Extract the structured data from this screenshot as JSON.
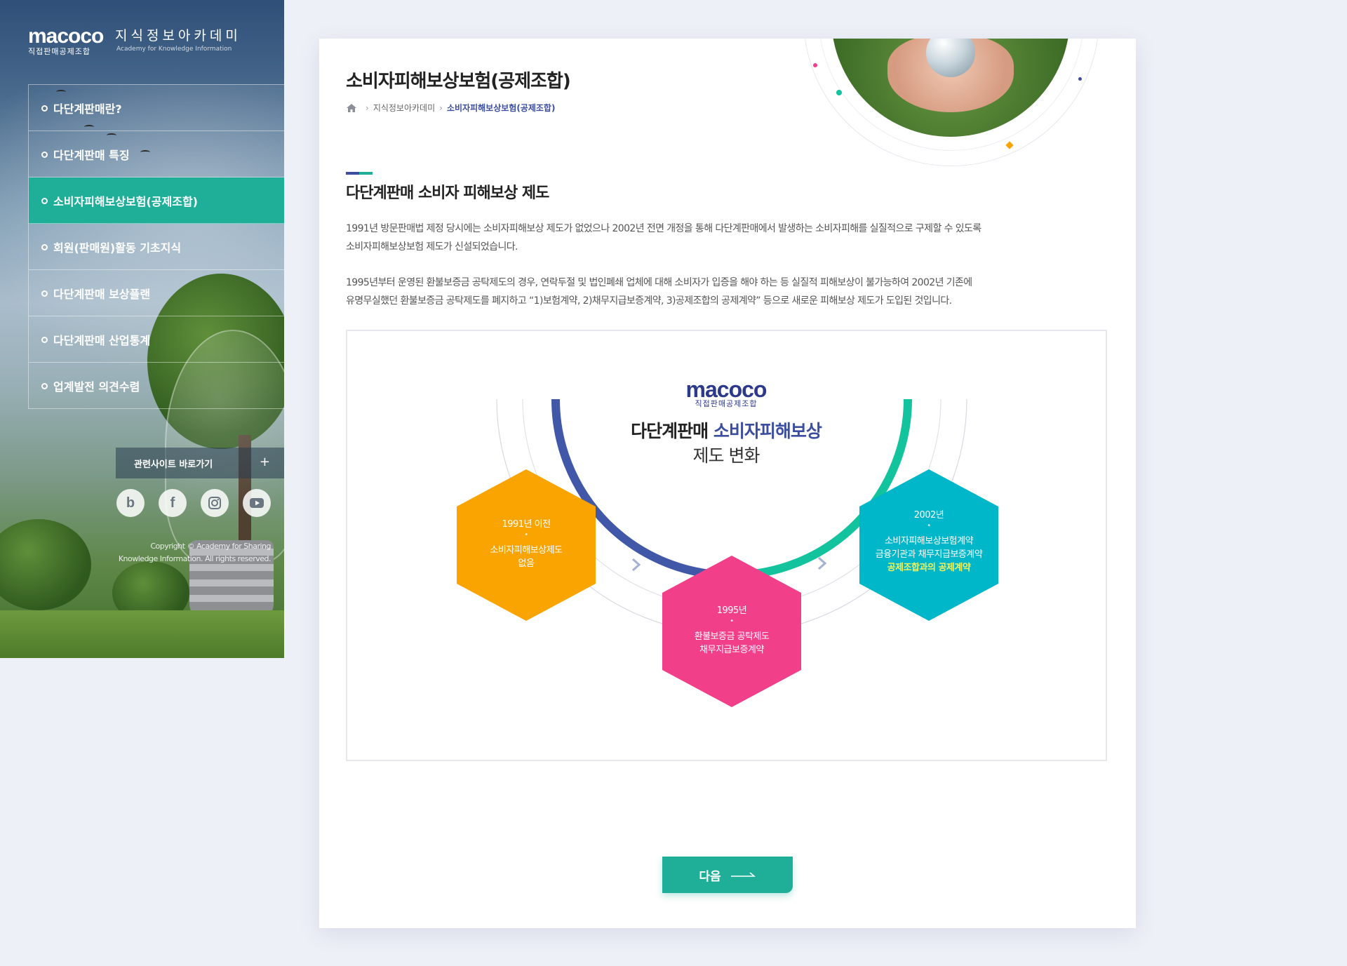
{
  "brand": {
    "logo_text": "macoco",
    "logo_sub_kr": "직접판매공제조합",
    "title_kr": "지식정보아카데미",
    "title_en": "Academy for Knowledge Information"
  },
  "sidebar": {
    "items": [
      {
        "label": "다단계판매란?",
        "active": false
      },
      {
        "label": "다단계판매 특징",
        "active": false
      },
      {
        "label": "소비자피해보상보험(공제조합)",
        "active": true
      },
      {
        "label": "회원(판매원)활동 기초지식",
        "active": false
      },
      {
        "label": "다단계판매 보상플랜",
        "active": false
      },
      {
        "label": "다단계판매 산업통계",
        "active": false
      },
      {
        "label": "업계발전 의견수렴",
        "active": false
      }
    ],
    "related_label": "관련사이트 바로가기",
    "related_plus": "+",
    "socials": [
      {
        "icon": "blog-icon",
        "glyph": "b"
      },
      {
        "icon": "facebook-icon",
        "glyph": "f"
      },
      {
        "icon": "instagram-icon",
        "glyph": ""
      },
      {
        "icon": "youtube-icon",
        "glyph": ""
      }
    ],
    "copyright_line1": "Copyright © Academy for Sharing",
    "copyright_line2": "Knowledge Information. All rights reserved."
  },
  "main": {
    "page_title": "소비자피해보상보험(공제조합)",
    "breadcrumb": [
      "지식정보아카데미",
      "소비자피해보상보험(공제조합)"
    ],
    "section_title": "다단계판매 소비자 피해보상 제도",
    "paragraph1_line1": "1991년 방문판매법 제정 당시에는 소비자피해보상 제도가 없었으나 2002년 전면 개정을 통해 다단계판매에서 발생하는 소비자피해를 실질적으로 구제할 수 있도록",
    "paragraph1_line2": "소비자피해보상보험 제도가 신설되었습니다.",
    "paragraph2_line1": "1995년부터 운영된 환불보증금 공탁제도의 경우, 연락두절 및 법인폐쇄 업체에 대해 소비자가 입증을 해야 하는 등 실질적 피해보상이 불가능하여 2002년 기존에",
    "paragraph2_line2": "유명무실했던 환불보증금 공탁제도를 폐지하고 “1)보험계약, 2)채무지급보증계약, 3)공제조합의 공제계약” 등으로 새로운 피해보상 제도가 도입된 것입니다.",
    "next_label": "다음"
  },
  "diagram": {
    "logo_text": "macoco",
    "logo_sub": "직접판매공제조합",
    "title_plain": "다단계판매 ",
    "title_highlight": "소비자피해보상",
    "title_line2": "제도 변화",
    "hexes": [
      {
        "year": "1991년 이전",
        "line1": "소비자피해보상제도",
        "line2": "없음",
        "color": "#f9a400"
      },
      {
        "year": "1995년",
        "line1": "환불보증금 공탁제도",
        "line2": "채무지급보증계약",
        "color": "#f23f8a"
      },
      {
        "year": "2002년",
        "line1": "소비자피해보상보험계약",
        "line2": "금융기관과 채무지급보증계약",
        "line3": "공제조합과의 공제계약",
        "color": "#00b6c9"
      }
    ],
    "colors": {
      "arc_left": "#4157a8",
      "arc_right": "#13c39e"
    }
  }
}
